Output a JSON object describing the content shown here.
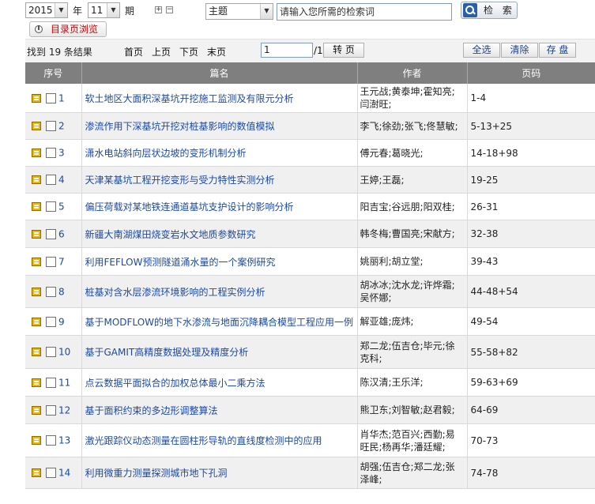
{
  "search": {
    "year": "2015",
    "year_label": "年",
    "issue": "11",
    "issue_label": "期",
    "plus": "+",
    "minus": "−",
    "field": "主题",
    "keyword_placeholder": "请输入您所需的检索词",
    "search_label": "检 索",
    "directory_label": "目录页浏览"
  },
  "results": {
    "found_text": "找到 19 条结果",
    "first": "首页",
    "prev": "上页",
    "next": "下页",
    "last": "末页",
    "page_value": "1",
    "page_total": "/1",
    "go": "转 页",
    "select_all": "全选",
    "clear": "清除",
    "save": "存 盘"
  },
  "table": {
    "headers": {
      "no": "序号",
      "title": "篇名",
      "author": "作者",
      "pages": "页码"
    },
    "rows": [
      {
        "no": "1",
        "title": "软土地区大面积深基坑开挖施工监测及有限元分析",
        "author": "王元战;黄泰坤;霍知亮;闫澍旺;",
        "pages": "1-4"
      },
      {
        "no": "2",
        "title": "渗流作用下深基坑开挖对桩基影响的数值模拟",
        "author": "李飞;徐劲;张飞;佟慧敏;",
        "pages": "5-13+25"
      },
      {
        "no": "3",
        "title": "潇水电站斜向层状边坡的变形机制分析",
        "author": "傅元春;葛晓光;",
        "pages": "14-18+98"
      },
      {
        "no": "4",
        "title": "天津某基坑工程开挖变形与受力特性实测分析",
        "author": "王婷;王磊;",
        "pages": "19-25"
      },
      {
        "no": "5",
        "title": "偏压荷载对某地铁连通道基坑支护设计的影响分析",
        "author": "阳吉宝;谷远朋;阳双桂;",
        "pages": "26-31"
      },
      {
        "no": "6",
        "title": "新疆大南湖煤田烧变岩水文地质参数研究",
        "author": "韩冬梅;曹国亮;宋献方;",
        "pages": "32-38"
      },
      {
        "no": "7",
        "title": "利用FEFLOW预测隧道涌水量的一个案例研究",
        "author": "姚丽利;胡立堂;",
        "pages": "39-43"
      },
      {
        "no": "8",
        "title": "桩基对含水层渗流环境影响的工程实例分析",
        "author": "胡冰冰;沈水龙;许烨霜;吴怀娜;",
        "pages": "44-48+54"
      },
      {
        "no": "9",
        "title": "基于MODFLOW的地下水渗流与地面沉降耦合模型工程应用一例",
        "author": "解亚雄;庞炜;",
        "pages": "49-54"
      },
      {
        "no": "10",
        "title": "基于GAMIT高精度数据处理及精度分析",
        "author": "郑二龙;伍吉仓;毕元;徐克科;",
        "pages": "55-58+82"
      },
      {
        "no": "11",
        "title": "点云数据平面拟合的加权总体最小二乘方法",
        "author": "陈汉清;王乐洋;",
        "pages": "59-63+69"
      },
      {
        "no": "12",
        "title": "基于面积约束的多边形调整算法",
        "author": "熊卫东;刘智敏;赵君毅;",
        "pages": "64-69"
      },
      {
        "no": "13",
        "title": "激光跟踪仪动态测量在圆柱形导轨的直线度检测中的应用",
        "author": "肖华杰;范百兴;西勤;易旺民;杨再华;潘廷耀;",
        "pages": "70-73"
      },
      {
        "no": "14",
        "title": "利用微重力测量探测城市地下孔洞",
        "author": "胡强;伍吉仓;郑二龙;张泽峰;",
        "pages": "74-78"
      }
    ]
  }
}
